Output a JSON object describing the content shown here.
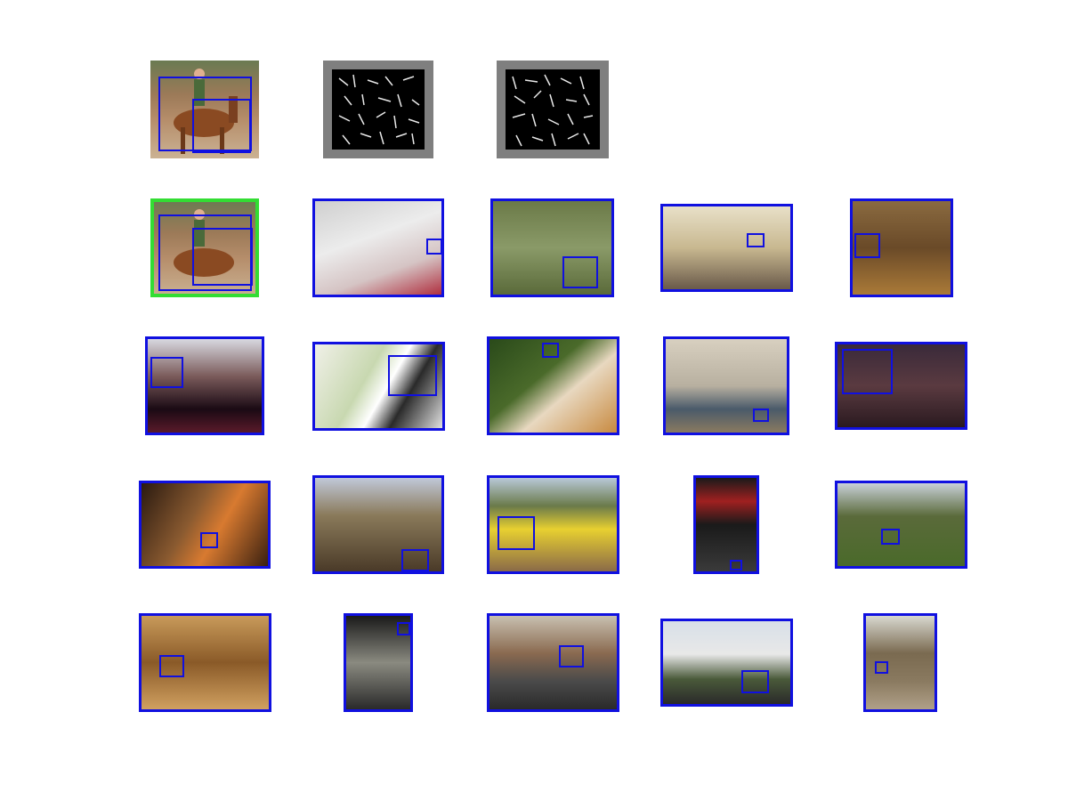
{
  "colors": {
    "detection_box": "#1010e0",
    "ground_truth_box": "#33dd33",
    "filter_background": "#7f7f7f"
  },
  "query": {
    "image": "horse-and-rider-photo",
    "filters": [
      "hog-filter-visualization",
      "hog-filter-visualization"
    ]
  },
  "results": [
    "horse-and-rider-photo",
    "white-cat-photo",
    "bird-on-branch-photo",
    "living-room-photo",
    "painted-tv-sets-photo",
    "black-cat-window-photo",
    "puppy-photo",
    "calico-cat-photo",
    "cactus-pot-photo",
    "bicycle-photo",
    "person-in-bar-photo",
    "kitchen-window-photo",
    "yellow-car-photo",
    "band-on-stage-photo",
    "bird-in-flight-photo",
    "cat-on-shelf-photo",
    "cat-in-woods-photo",
    "computer-desk-photo",
    "airplane-photo",
    "stone-ruin-photo"
  ]
}
